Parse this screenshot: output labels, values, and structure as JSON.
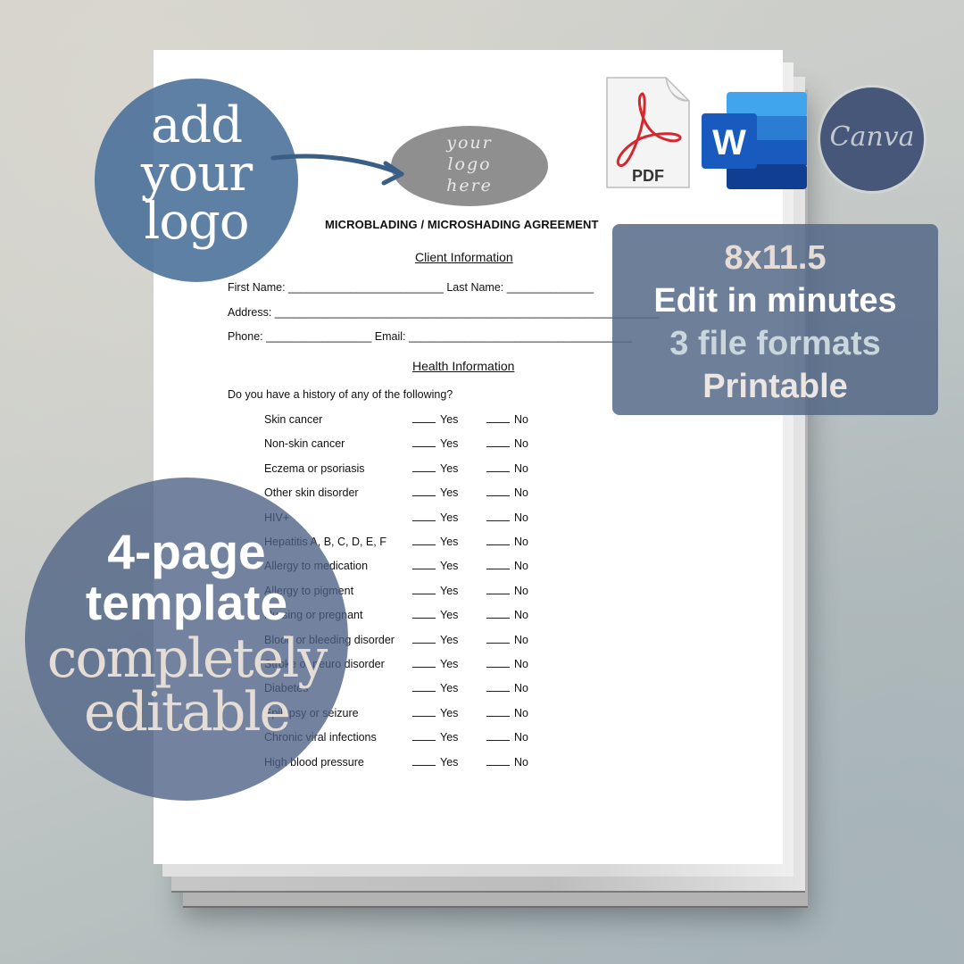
{
  "document": {
    "logo_placeholder": [
      "your",
      "logo",
      "here"
    ],
    "title": "MICROBLADING / MICROSHADING AGREEMENT",
    "client_section": "Client Information",
    "fields": {
      "first_name": "First Name: _________________________",
      "last_name": "Last Name: ______________",
      "address": "Address: ______________________________________________________________",
      "phone": "Phone: _________________",
      "email": "Email: ____________________________________"
    },
    "health_section": "Health Information",
    "question": "Do you have a history of any of the following?",
    "yes_label": "Yes",
    "no_label": "No",
    "conditions": [
      "Skin cancer",
      "Non-skin cancer",
      "Eczema or psoriasis",
      "Other skin disorder",
      "HIV+",
      "Hepatitis A, B, C, D, E, F",
      "Allergy to medication",
      "Allergy to pigment",
      "Nursing or pregnant",
      "Blood or bleeding disorder",
      "Stroke or neuro disorder",
      "Diabetes",
      "Epilepsy or seizure",
      "Chronic viral infections",
      "High blood pressure"
    ]
  },
  "badges": {
    "add_logo": [
      "add",
      "your",
      "logo"
    ],
    "pdf_label": "PDF",
    "word_letter": "W",
    "canva_label": "Canva",
    "info_lines": [
      {
        "text": "8x11.5",
        "color": "#e6dcd6"
      },
      {
        "text": "Edit in minutes",
        "color": "#ffffff"
      },
      {
        "text": "3 file formats",
        "color": "#c9d6dc"
      },
      {
        "text": "Printable",
        "color": "#ece6e2"
      }
    ],
    "template_bold": [
      "4-page",
      "template"
    ],
    "template_serif": [
      "completely",
      "editable"
    ]
  },
  "colors": {
    "accent_blue": "#486e98",
    "navy": "#465779",
    "word_blue": "#185abd"
  }
}
